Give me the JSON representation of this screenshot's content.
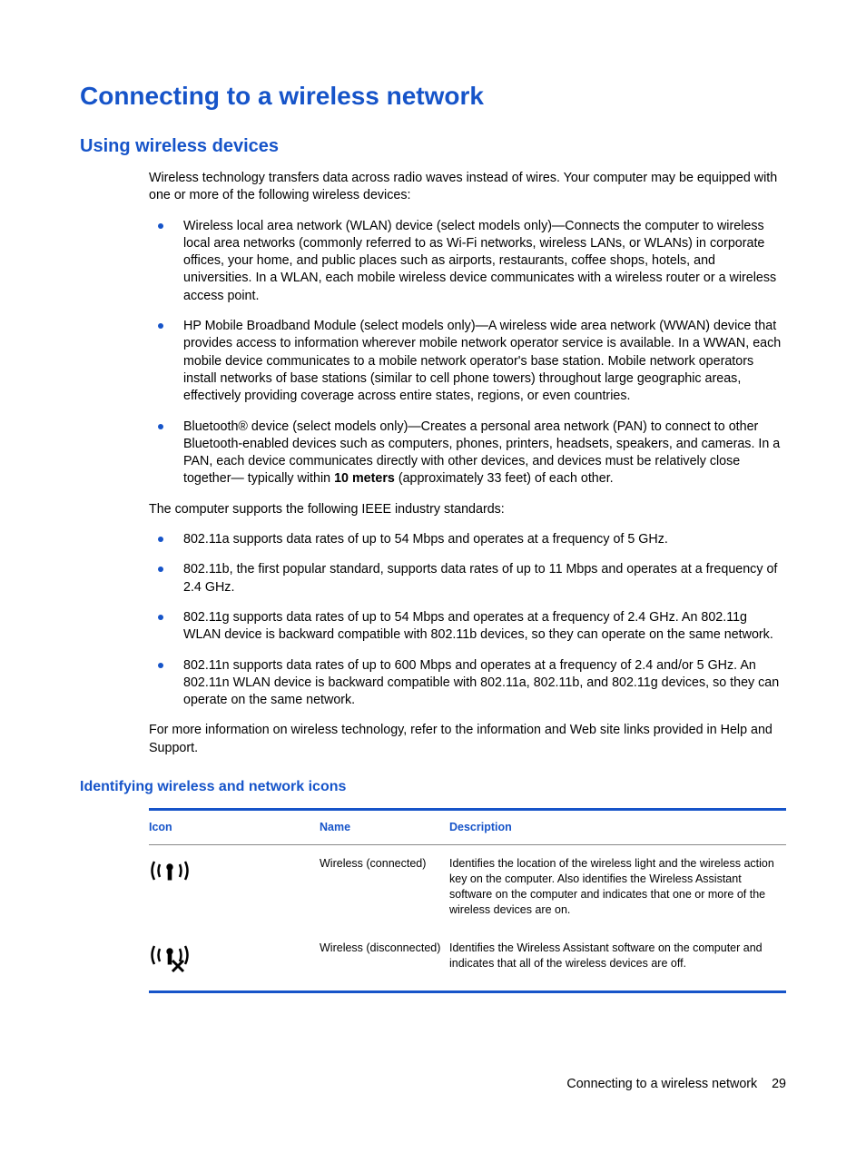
{
  "h1": "Connecting to a wireless network",
  "h2": "Using wireless devices",
  "intro": "Wireless technology transfers data across radio waves instead of wires. Your computer may be equipped with one or more of the following wireless devices:",
  "devices": [
    "Wireless local area network (WLAN) device (select models only)—Connects the computer to wireless local area networks (commonly referred to as Wi-Fi networks, wireless LANs, or WLANs) in corporate offices, your home, and public places such as airports, restaurants, coffee shops, hotels, and universities. In a WLAN, each mobile wireless device communicates with a wireless router or a wireless access point.",
    "HP Mobile Broadband Module (select models only)—A wireless wide area network (WWAN) device that provides access to information wherever mobile network operator service is available. In a WWAN, each mobile device communicates to a mobile network operator's base station. Mobile network operators install networks of base stations (similar to cell phone towers) throughout large geographic areas, effectively providing coverage across entire states, regions, or even countries."
  ],
  "bt_pre": "Bluetooth® device (select models only)—Creates a personal area network (PAN) to connect to other Bluetooth-enabled devices such as computers, phones, printers, headsets, speakers, and cameras. In a PAN, each device communicates directly with other devices, and devices must be relatively close together— typically within ",
  "bt_bold": "10 meters",
  "bt_post": " (approximately 33 feet) of each other.",
  "standards_intro": "The computer  supports the following IEEE industry standards:",
  "standards": [
    "802.11a supports data rates of up to 54 Mbps and operates at a frequency of 5 GHz.",
    "802.11b, the first popular standard, supports data rates of up to 11 Mbps and operates at a frequency of 2.4 GHz.",
    "802.11g supports data rates of up to 54 Mbps and operates at a frequency of 2.4 GHz. An 802.11g WLAN device is backward compatible with 802.11b devices, so they can operate on the same network.",
    "802.11n supports data rates of up to 600 Mbps and operates at a frequency of 2.4 and/or 5 GHz. An 802.11n WLAN device is backward compatible with 802.11a, 802.11b, and 802.11g devices, so they can operate on the same network."
  ],
  "more_info": "For more information on wireless technology, refer to the information and Web site links provided in Help and Support.",
  "h3": "Identifying wireless and network icons",
  "table": {
    "headers": {
      "icon": "Icon",
      "name": "Name",
      "desc": "Description"
    },
    "rows": [
      {
        "name": "Wireless (connected)",
        "desc": "Identifies the location of the wireless light and the wireless action key on the computer. Also identifies the Wireless Assistant software on the computer and indicates that one or more of the wireless devices are on."
      },
      {
        "name": "Wireless (disconnected)",
        "desc": "Identifies the Wireless Assistant software on the computer and indicates that all of the wireless devices are off."
      }
    ]
  },
  "footer_text": "Connecting to a wireless network",
  "page_number": "29"
}
